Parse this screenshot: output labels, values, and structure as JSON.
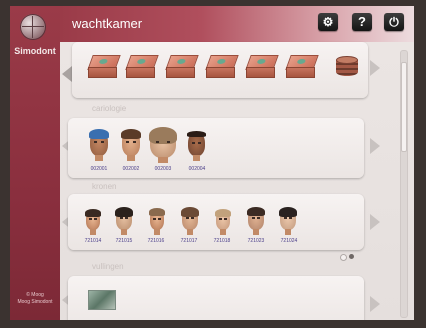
{
  "app": {
    "title": "wachtkamer",
    "logo_text": "Simodont",
    "sidebar_footer": "© Moog\nMoog Simodont"
  },
  "toolbar": {
    "settings_icon": "gears-icon",
    "help_label": "?",
    "power_icon": "power-icon"
  },
  "categories": [
    {
      "label": "cariologie",
      "type": "cases",
      "items": [
        "case-1",
        "case-2",
        "case-3",
        "case-4",
        "case-5",
        "case-6",
        "case-7"
      ]
    },
    {
      "label": "",
      "type": "faces",
      "items": [
        {
          "id": "002001",
          "hair": "#3a6fb0",
          "skin": "#c48763"
        },
        {
          "id": "002002",
          "hair": "#5a3b28",
          "skin": "#d9a481"
        },
        {
          "id": "002003",
          "hair": "#9a7b5c",
          "skin": "#e2b99a"
        },
        {
          "id": "002004",
          "hair": "#2a1c16",
          "skin": "#9a6444"
        }
      ]
    },
    {
      "label": "kronen",
      "type": "faces",
      "items": [
        {
          "id": "721014",
          "hair": "#3a2a22",
          "skin": "#c99574"
        },
        {
          "id": "721015",
          "hair": "#2b211c",
          "skin": "#e0b898"
        },
        {
          "id": "721016",
          "hair": "#8a6a4e",
          "skin": "#d6a584"
        },
        {
          "id": "721017",
          "hair": "#6b4a35",
          "skin": "#dcae8c"
        },
        {
          "id": "721018",
          "hair": "#c2a27c",
          "skin": "#e4bb9b"
        },
        {
          "id": "721023",
          "hair": "#3b2a23",
          "skin": "#d7a988"
        },
        {
          "id": "721024",
          "hair": "#2a2220",
          "skin": "#e3bea2"
        }
      ]
    },
    {
      "label": "vullingen",
      "type": "thumbnails",
      "items": [
        "thumb-1"
      ]
    }
  ],
  "pager": {
    "count": 2,
    "active": 1
  },
  "colors": {
    "sidebar": "#8a2f3e",
    "arrow": "#c8c2c0",
    "label_text": "#4b3f8a"
  }
}
